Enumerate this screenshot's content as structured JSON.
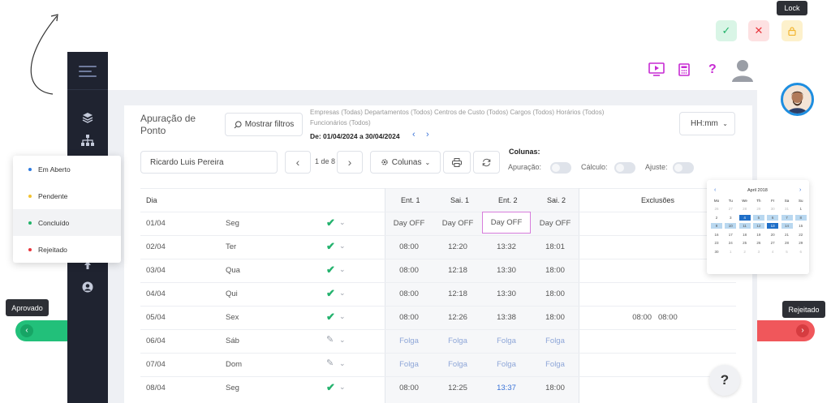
{
  "lock_tooltip": "Lock",
  "page_title": "Apuração de Ponto",
  "filters_button": "Mostrar filtros",
  "filter_summary": {
    "line1": "Empresas (Todas)  Departamentos (Todos)  Centros de Custo (Todos)  Cargos (Todos)  Horários (Todos)",
    "line2": "Funcionários (Todos)",
    "period": "De: 01/04/2024 a 30/04/2024"
  },
  "time_format": "HH:mm",
  "employee": "Ricardo Luis Pereira",
  "pagination": "1 de 8",
  "columns_button": "Colunas",
  "columns_panel": {
    "title": "Colunas:",
    "apuracao": "Apuração:",
    "calculo": "Cálculo:",
    "ajuste": "Ajuste:"
  },
  "table": {
    "headers": {
      "dia": "Dia",
      "ent1": "Ent. 1",
      "sai1": "Sai. 1",
      "ent2": "Ent. 2",
      "sai2": "Sai. 2",
      "exclusoes": "Exclusões"
    },
    "rows": [
      {
        "date": "01/04",
        "weekday": "Seg",
        "status": "check",
        "ent1": "Day OFF",
        "sai1": "Day OFF",
        "ent2": "Day OFF",
        "sai2": "Day OFF",
        "exclusoes": ""
      },
      {
        "date": "02/04",
        "weekday": "Ter",
        "status": "check",
        "ent1": "08:00",
        "sai1": "12:20",
        "ent2": "13:32",
        "sai2": "18:01",
        "exclusoes": ""
      },
      {
        "date": "03/04",
        "weekday": "Qua",
        "status": "check",
        "ent1": "08:00",
        "sai1": "12:18",
        "ent2": "13:30",
        "sai2": "18:00",
        "exclusoes": ""
      },
      {
        "date": "04/04",
        "weekday": "Qui",
        "status": "check",
        "ent1": "08:00",
        "sai1": "12:18",
        "ent2": "13:30",
        "sai2": "18:00",
        "exclusoes": ""
      },
      {
        "date": "05/04",
        "weekday": "Sex",
        "status": "check",
        "ent1": "08:00",
        "sai1": "12:26",
        "ent2": "13:38",
        "sai2": "18:00",
        "exclusoes": "08:00   08:00"
      },
      {
        "date": "06/04",
        "weekday": "Sáb",
        "status": "edit",
        "ent1": "Folga",
        "sai1": "Folga",
        "ent2": "Folga",
        "sai2": "Folga",
        "exclusoes": ""
      },
      {
        "date": "07/04",
        "weekday": "Dom",
        "status": "edit",
        "ent1": "Folga",
        "sai1": "Folga",
        "ent2": "Folga",
        "sai2": "Folga",
        "exclusoes": ""
      },
      {
        "date": "08/04",
        "weekday": "Seg",
        "status": "check",
        "ent1": "08:00",
        "sai1": "12:25",
        "ent2": "13:37",
        "sai2": "18:00",
        "exclusoes": ""
      }
    ]
  },
  "status_menu": [
    {
      "label": "Em Aberto",
      "color": "#2f7be0"
    },
    {
      "label": "Pendente",
      "color": "#f2c230"
    },
    {
      "label": "Concluído",
      "color": "#22b36a"
    },
    {
      "label": "Rejeitado",
      "color": "#e8363d"
    }
  ],
  "calendar": {
    "title": "April 2018",
    "weekdays": [
      "Mo",
      "Tu",
      "We",
      "Th",
      "Fr",
      "Sa",
      "Su"
    ],
    "weeks": [
      [
        "26",
        "27",
        "28",
        "29",
        "30",
        "31",
        "1"
      ],
      [
        "2",
        "3",
        "4",
        "5",
        "6",
        "7",
        "8"
      ],
      [
        "9",
        "10",
        "11",
        "12",
        "13",
        "14",
        "15"
      ],
      [
        "16",
        "17",
        "18",
        "19",
        "20",
        "21",
        "22"
      ],
      [
        "23",
        "24",
        "25",
        "26",
        "27",
        "28",
        "29"
      ],
      [
        "30",
        "1",
        "2",
        "3",
        "4",
        "5",
        "6"
      ]
    ]
  },
  "approve_tooltip": "Aprovado",
  "reject_tooltip": "Rejeitado",
  "help_label": "?",
  "colors": {
    "accent": "#c72bd3",
    "sidebar": "#1f2330",
    "approve": "#22c07a",
    "reject": "#f0575b"
  }
}
